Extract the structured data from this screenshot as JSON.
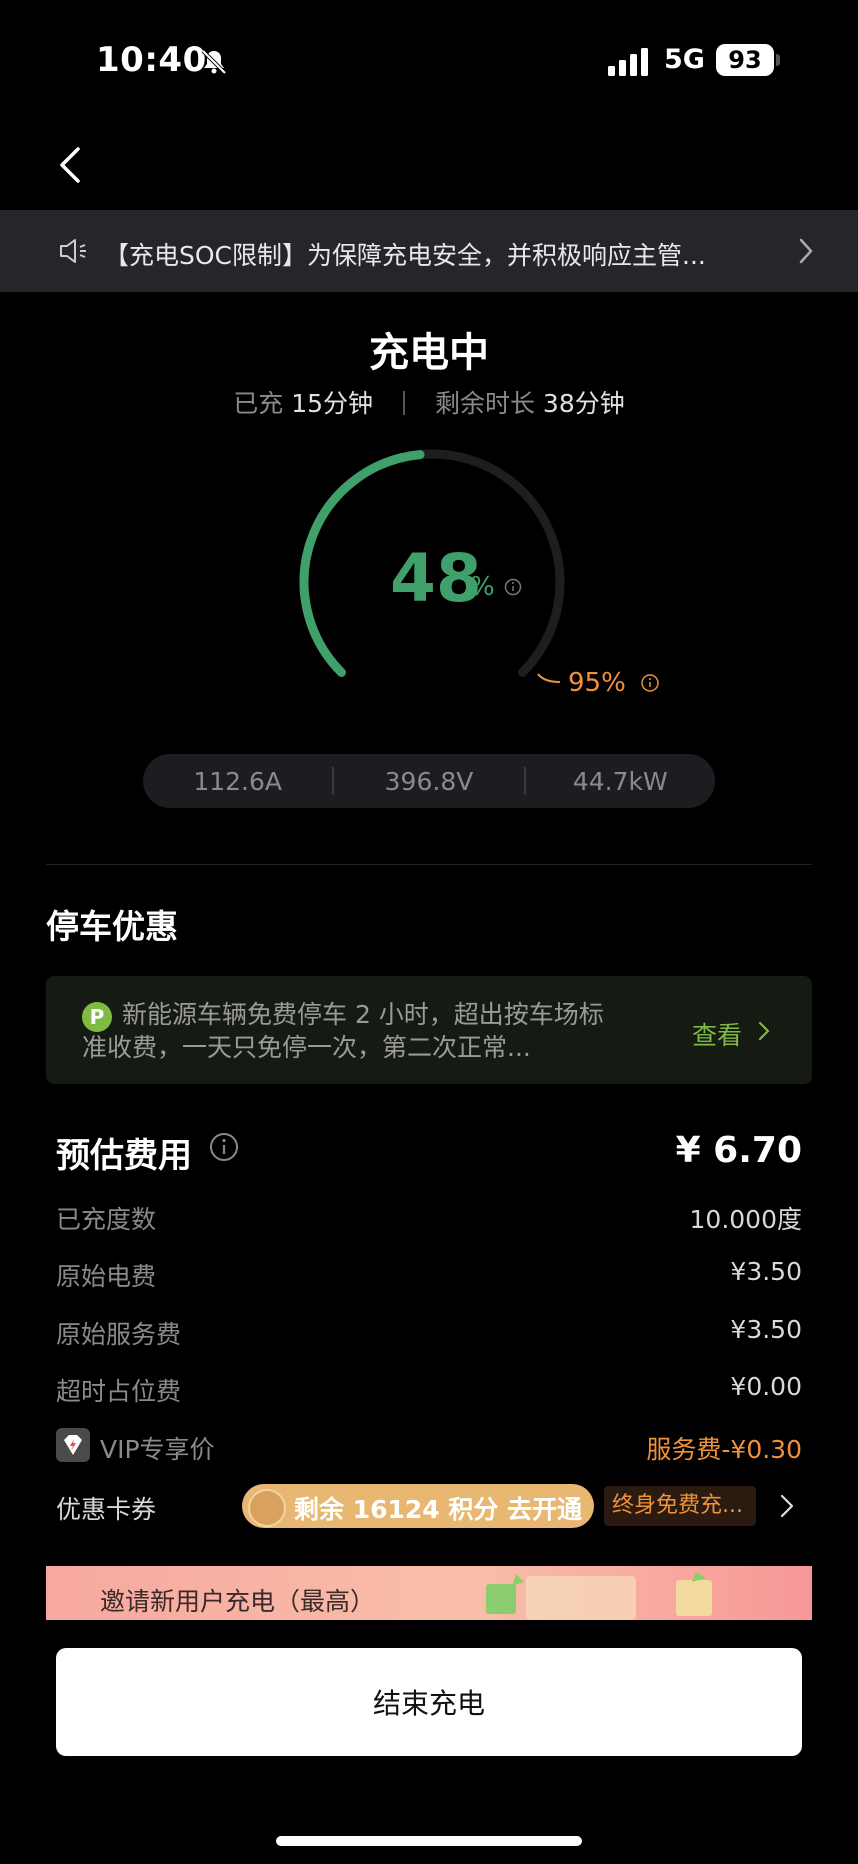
{
  "status_bar": {
    "time": "10:40",
    "network": "5G",
    "battery": "93"
  },
  "notice": {
    "text": "【充电SOC限制】为保障充电安全，并积极响应主管..."
  },
  "charging": {
    "title": "充电中",
    "charged_label": "已充",
    "charged_value": "15分钟",
    "remaining_label": "剩余时长",
    "remaining_value": "38分钟",
    "soc": "48",
    "soc_unit": "%",
    "soc_fraction": 0.48,
    "limit": "95%",
    "limit_fraction": 0.95,
    "current": "112.6A",
    "voltage": "396.8V",
    "power": "44.7kW"
  },
  "parking": {
    "title": "停车优惠",
    "badge": "P",
    "text": "新能源车辆免费停车 2 小时，超出按车场标准收费，一天只免停一次，第二次正常...",
    "link": "查看"
  },
  "cost": {
    "title": "预估费用",
    "total": "¥ 6.70",
    "rows": [
      {
        "label": "已充度数",
        "value": "10.000度"
      },
      {
        "label": "原始电费",
        "value": "¥3.50"
      },
      {
        "label": "原始服务费",
        "value": "¥3.50"
      },
      {
        "label": "超时占位费",
        "value": "¥0.00"
      }
    ],
    "vip_label": "VIP专享价",
    "vip_value": "服务费-¥0.30",
    "coupon_label": "优惠卡券",
    "coupon_pill": "剩余 16124 积分 去开通",
    "coupon_tag": "终身免费充..."
  },
  "banner": {
    "text": "邀请新用户充电（最高）"
  },
  "end_button": "结束充电",
  "colors": {
    "accent_green": "#3fa06c",
    "accent_orange": "#f0923a",
    "park_green": "#7fba42"
  }
}
